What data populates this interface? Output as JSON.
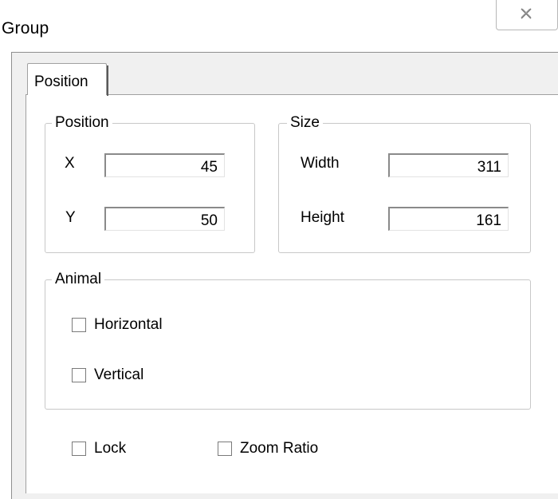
{
  "window": {
    "title": "Group",
    "close_icon": "close-icon"
  },
  "tabs": [
    {
      "label": "Position",
      "selected": true
    }
  ],
  "position_group": {
    "legend": "Position",
    "x_label": "X",
    "x_value": "45",
    "y_label": "Y",
    "y_value": "50"
  },
  "size_group": {
    "legend": "Size",
    "width_label": "Width",
    "width_value": "311",
    "height_label": "Height",
    "height_value": "161"
  },
  "animal_group": {
    "legend": "Animal",
    "horizontal_label": "Horizontal",
    "horizontal_checked": false,
    "vertical_label": "Vertical",
    "vertical_checked": false
  },
  "options": {
    "lock_label": "Lock",
    "lock_checked": false,
    "zoom_ratio_label": "Zoom Ratio",
    "zoom_ratio_checked": false
  }
}
